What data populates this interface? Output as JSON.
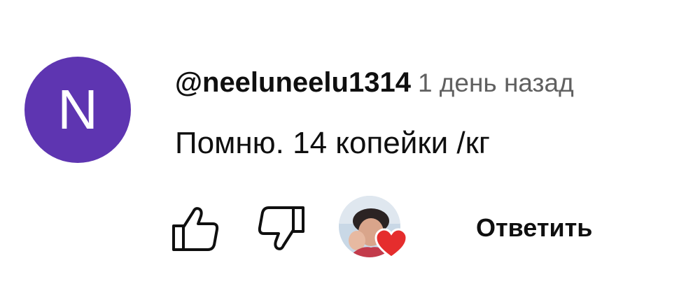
{
  "comment": {
    "avatar_letter": "N",
    "avatar_color": "#5e35b1",
    "author": "@neeluneelu1314",
    "time": "1 день назад",
    "text": "Помню. 14 копейки /кг"
  },
  "actions": {
    "like_icon": "thumb-up-icon",
    "dislike_icon": "thumb-down-icon",
    "creator_heart_color": "#e52d2d",
    "reply_label": "Ответить"
  }
}
